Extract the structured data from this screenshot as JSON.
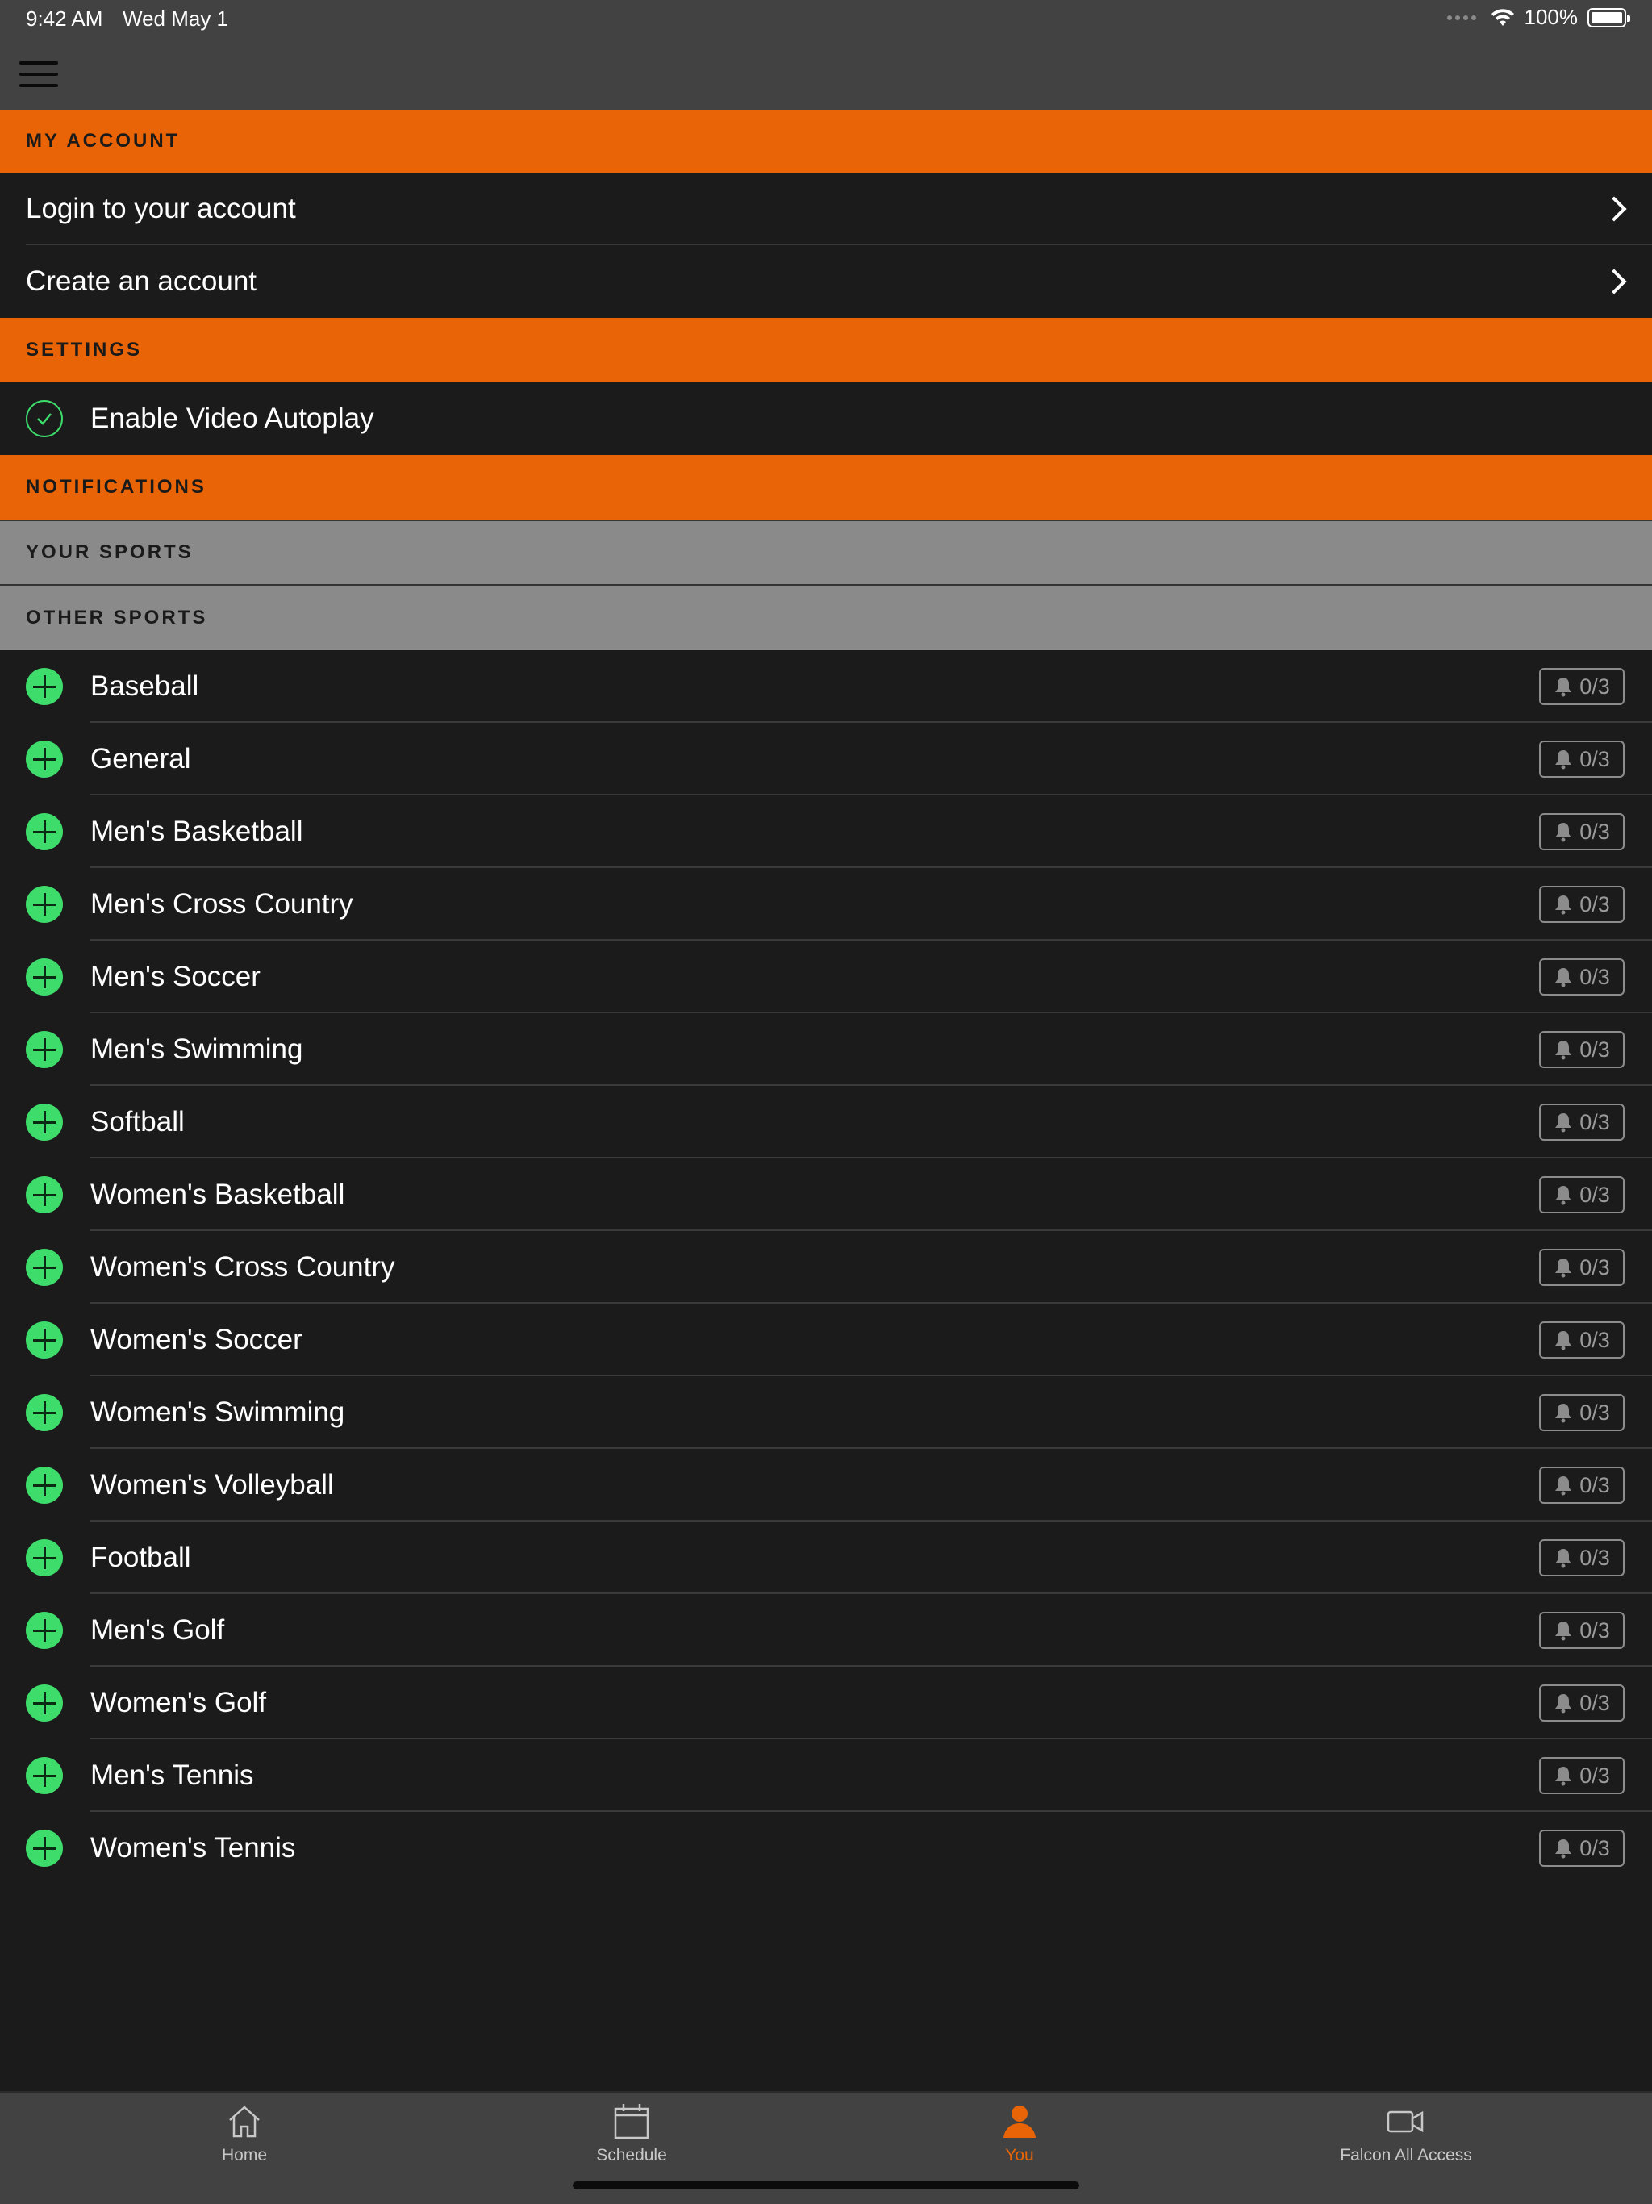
{
  "status_bar": {
    "time": "9:42 AM",
    "date": "Wed May 1",
    "battery": "100%"
  },
  "sections": {
    "my_account": "MY ACCOUNT",
    "settings": "SETTINGS",
    "notifications": "NOTIFICATIONS",
    "your_sports": "YOUR SPORTS",
    "other_sports": "OTHER SPORTS"
  },
  "account": {
    "login": "Login to your account",
    "create": "Create an account"
  },
  "settings": {
    "autoplay": "Enable Video Autoplay"
  },
  "sports": [
    {
      "name": "Baseball",
      "count": "0/3"
    },
    {
      "name": "General",
      "count": "0/3"
    },
    {
      "name": "Men's Basketball",
      "count": "0/3"
    },
    {
      "name": "Men's Cross Country",
      "count": "0/3"
    },
    {
      "name": "Men's Soccer",
      "count": "0/3"
    },
    {
      "name": "Men's Swimming",
      "count": "0/3"
    },
    {
      "name": "Softball",
      "count": "0/3"
    },
    {
      "name": "Women's Basketball",
      "count": "0/3"
    },
    {
      "name": "Women's Cross Country",
      "count": "0/3"
    },
    {
      "name": "Women's Soccer",
      "count": "0/3"
    },
    {
      "name": "Women's Swimming",
      "count": "0/3"
    },
    {
      "name": "Women's Volleyball",
      "count": "0/3"
    },
    {
      "name": "Football",
      "count": "0/3"
    },
    {
      "name": "Men's Golf",
      "count": "0/3"
    },
    {
      "name": "Women's Golf",
      "count": "0/3"
    },
    {
      "name": "Men's Tennis",
      "count": "0/3"
    },
    {
      "name": "Women's Tennis",
      "count": "0/3"
    }
  ],
  "tabs": [
    {
      "label": "Home",
      "icon": "home-icon"
    },
    {
      "label": "Schedule",
      "icon": "calendar-icon"
    },
    {
      "label": "You",
      "icon": "person-icon"
    },
    {
      "label": "Falcon All Access",
      "icon": "video-icon"
    }
  ],
  "colors": {
    "accent": "#e86406",
    "add_green": "#3ddc6b",
    "background": "#1b1b1c",
    "subheader_grey": "#8a8a8a"
  }
}
